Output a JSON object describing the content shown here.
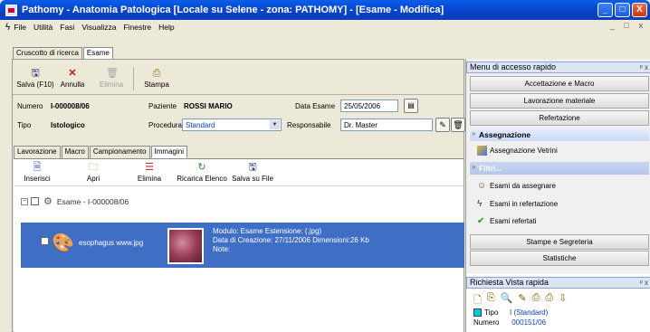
{
  "window": {
    "title": "Pathomy - Anatomia Patologica [Locale su Selene - zona: PATHOMY] - [Esame - Modifica]",
    "min_label": "_",
    "max_label": "□",
    "close_label": "X"
  },
  "menu": {
    "items": [
      "File",
      "Utilità",
      "Fasi",
      "Visualizza",
      "Finestre",
      "Help"
    ],
    "mdi_controls": "_ ð X"
  },
  "doc_tabs": [
    "Cruscotto di ricerca",
    "Esame"
  ],
  "toolbar": {
    "save": "Salva (F10)",
    "cancel": "Annulla",
    "delete": "Elimina",
    "print": "Stampa"
  },
  "exam": {
    "numero_label": "Numero",
    "numero_value": "I-000008/06",
    "paziente_label": "Paziente",
    "paziente_value": "ROSSI MARIO",
    "data_label": "Data Esame",
    "data_value": "25/05/2006",
    "tipo_label": "Tipo",
    "tipo_value": "Istologico",
    "procedura_label": "Procedura",
    "procedura_value": "Standard",
    "responsabile_label": "Responsabile",
    "responsabile_value": "Dr. Master"
  },
  "sub_tabs": [
    "Lavorazione",
    "Macro",
    "Campionamento",
    "Immagini"
  ],
  "image_toolbar": {
    "insert": "Inserisci",
    "open": "Apri",
    "delete": "Elimina",
    "reload": "Ricarica Elenco",
    "save_file": "Salva su File"
  },
  "tree": {
    "root_label": "Esame - I-000008/06",
    "item_name": "esophagus www.jpg",
    "info_line1": "Modulo: Esame Estensione: (.jpg)",
    "info_line2": "Data di Creazione: 27/11/2006 Dimensioni:26 Kb",
    "info_line3": "Note:"
  },
  "quick_menu": {
    "title": "Menu di accesso rapido",
    "pin": "ᵖ x",
    "buttons_top": [
      "Accettazione e Macro",
      "Lavorazione materiale",
      "Refertazione"
    ],
    "group_assign": "Assegnazione",
    "assign_item": "Assegnazione Vetrini",
    "group_filters": "Filtri...",
    "filter_items": [
      "Esami da assegnare",
      "Esami in refertazione",
      "Esami refertati"
    ],
    "buttons_bottom": [
      "Stampe e Segreteria",
      "Statistiche"
    ]
  },
  "quick_view": {
    "title": "Richiesta Vista rapida",
    "pin": "ᵖ x",
    "tipo_label": "Tipo",
    "tipo_value": "I (Standard)",
    "numero_label": "Numero",
    "numero_value": "000151/06"
  },
  "colors": {
    "titlebar": "#0A4FD8",
    "selection": "#3F6EC5",
    "procedura_text": "#0A3FB8"
  }
}
